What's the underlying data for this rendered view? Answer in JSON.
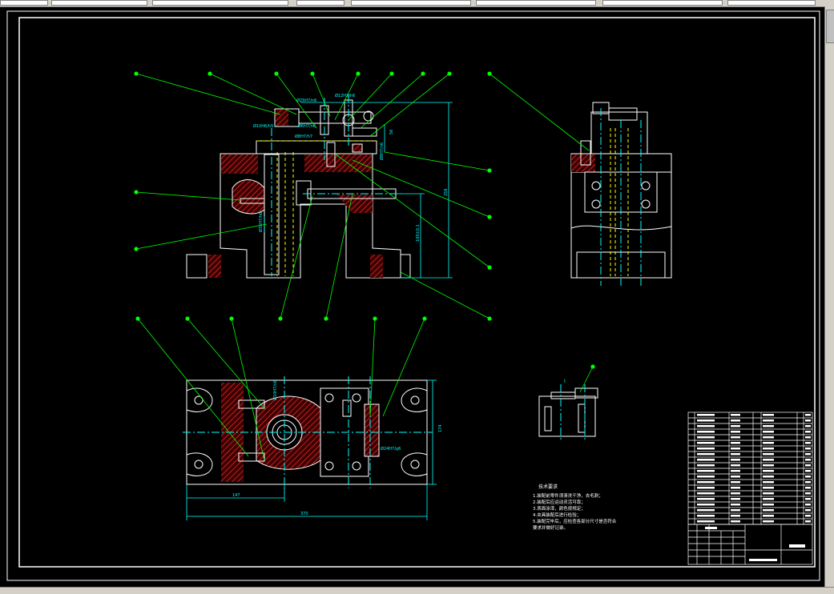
{
  "toolbar": {
    "layer_value": "",
    "status_text": ""
  },
  "drawing": {
    "dimensions": {
      "fit1": "Ø25H7/n6",
      "fit2": "Ø12H7/h6",
      "fit3": "Ø10H6/h5",
      "fit4": "Ø6H7/n6",
      "fit5": "Ø8H7/h7",
      "fit6": "Ø8H7/n6",
      "fit7": "Ø35H7/h6",
      "fit8": "Ø30H7/k6",
      "fit9": "Ø10H7/n6",
      "fit10": "Ø24H7/g6",
      "overall_height": "256",
      "shaft_height": "100±0.1",
      "gap": "56",
      "plan_width": "370",
      "plan_half": "147",
      "plan_height": "174",
      "detail_label": "Ⅰ"
    },
    "tech_req_title": "技术要求",
    "tech_req_lines": [
      "1.装配前零件须清洗干净，去毛刺；",
      "2.装配后应运动灵活可靠；",
      "3.表面涂漆，颜色按规定；",
      "4.夹具装配后进行检验；",
      "5.装配完毕后，应检查各部分尺寸是否符合",
      "要求并做好记录。"
    ],
    "balloon_count": 22
  },
  "colors": {
    "background": "#000000",
    "outline": "#ffffff",
    "leader": "#00ff00",
    "hidden": "#ffff00",
    "center": "#00ffff",
    "hatch": "#ff4040",
    "dimension": "#00ffff"
  }
}
